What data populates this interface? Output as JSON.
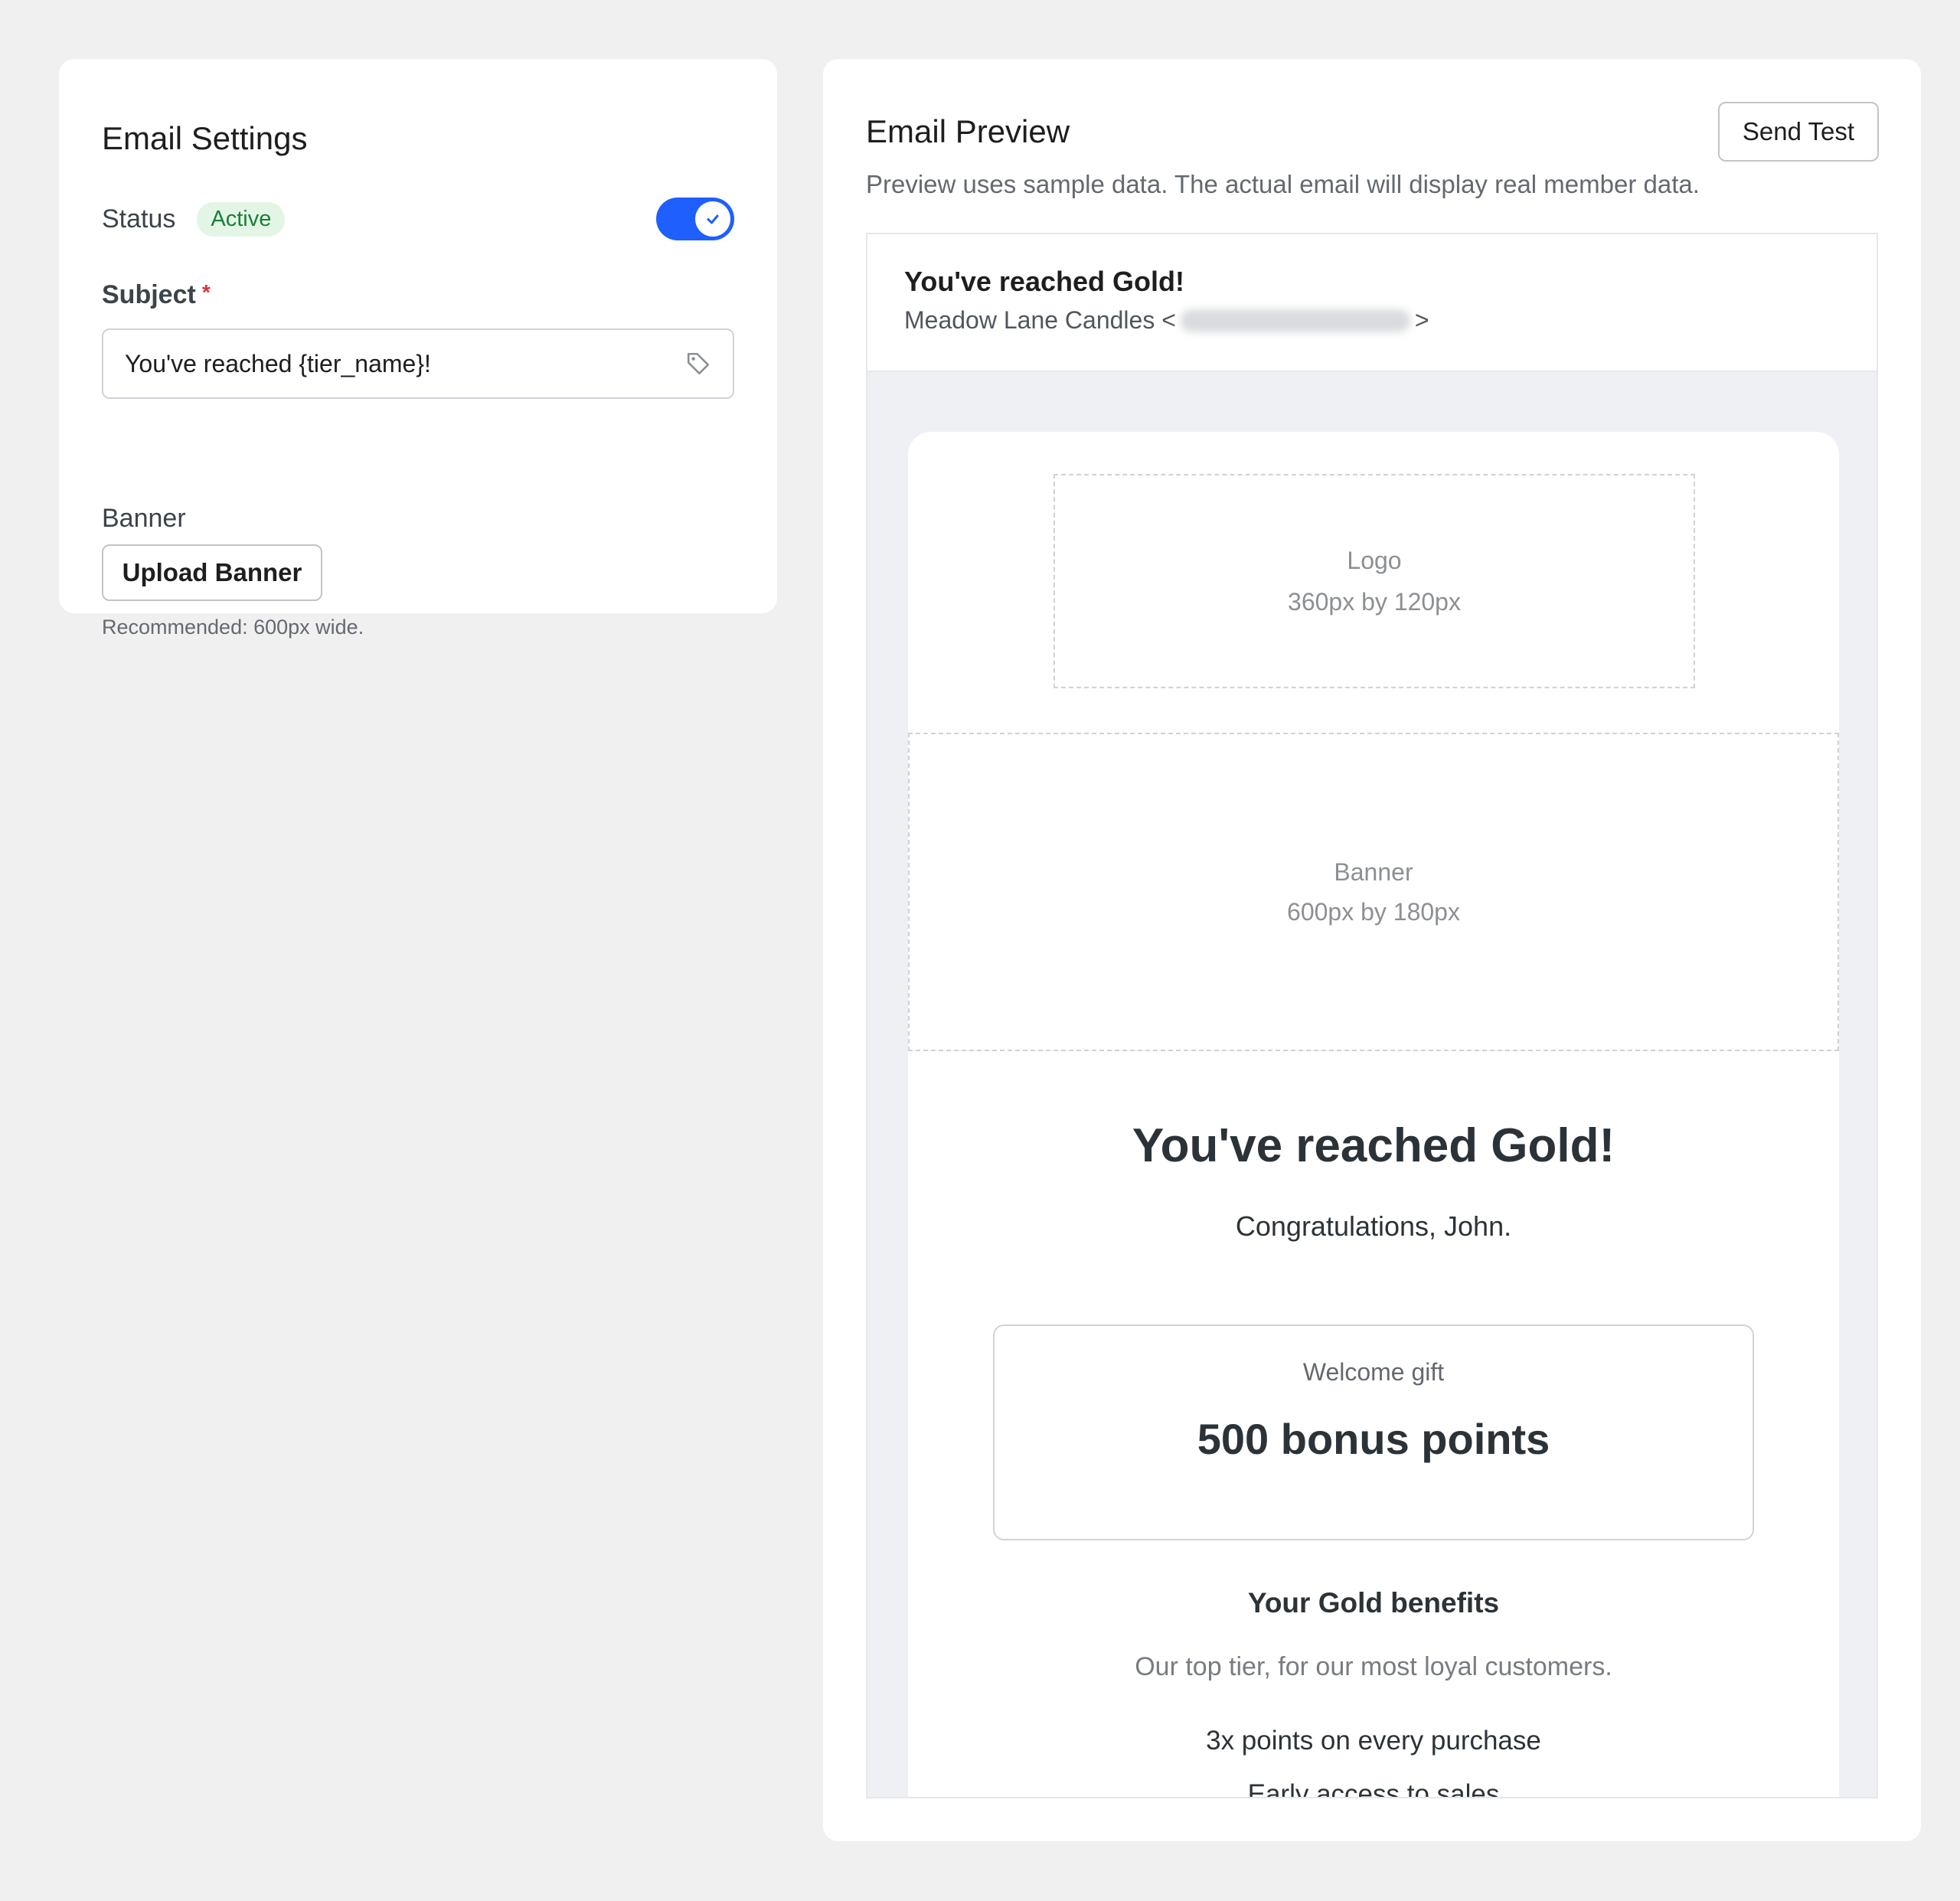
{
  "settings": {
    "title": "Email Settings",
    "status_label": "Status",
    "status_badge": "Active",
    "status_enabled": true,
    "subject_label": "Subject",
    "required_mark": "*",
    "subject_value": "You've reached {tier_name}!",
    "banner_label": "Banner",
    "upload_button": "Upload Banner",
    "hint": "Recommended: 600px wide."
  },
  "preview": {
    "title": "Email Preview",
    "send_test_button": "Send Test",
    "note": "Preview uses sample data. The actual email will display real member data.",
    "email": {
      "subject": "You've reached Gold!",
      "from_name": "Meadow Lane Candles <",
      "from_close": ">",
      "logo_placeholder": {
        "label": "Logo",
        "size": "360px by 120px"
      },
      "banner_placeholder": {
        "label": "Banner",
        "size": "600px by 180px"
      },
      "headline": "You've reached Gold!",
      "greeting": "Congratulations, John.",
      "gift": {
        "label": "Welcome gift",
        "value": "500 bonus points"
      },
      "benefits_title": "Your Gold benefits",
      "benefits_description": "Our top tier, for our most loyal customers.",
      "benefits": [
        "3x points on every purchase",
        "Early access to sales"
      ]
    }
  },
  "colors": {
    "accent": "#1f5ffe",
    "badge_bg": "#e3f6e6",
    "badge_text": "#1a7f37",
    "required": "#d63638"
  },
  "icons": [
    "check-icon",
    "tag-icon"
  ]
}
